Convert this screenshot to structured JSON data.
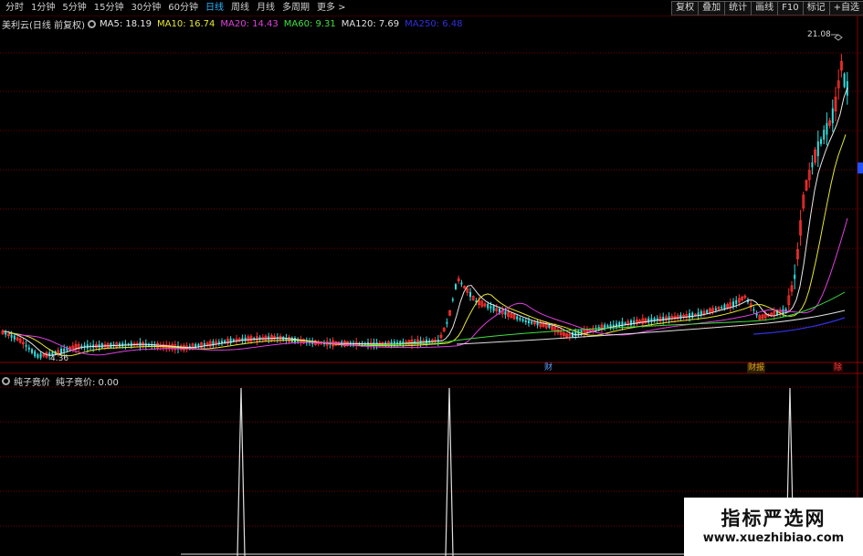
{
  "toolbar": {
    "periods": [
      {
        "label": "分时",
        "active": false
      },
      {
        "label": "1分钟",
        "active": false
      },
      {
        "label": "5分钟",
        "active": false
      },
      {
        "label": "15分钟",
        "active": false
      },
      {
        "label": "30分钟",
        "active": false
      },
      {
        "label": "60分钟",
        "active": false
      },
      {
        "label": "日线",
        "active": true
      },
      {
        "label": "周线",
        "active": false
      },
      {
        "label": "月线",
        "active": false
      },
      {
        "label": "多周期",
        "active": false
      },
      {
        "label": "更多 >",
        "active": false
      }
    ],
    "buttons": [
      "复权",
      "叠加",
      "统计",
      "画线",
      "F10",
      "标记",
      "+自选"
    ]
  },
  "legend": {
    "stock_title": "美利云(日线 前复权)",
    "ma": [
      {
        "label": "MA5: 18.19",
        "color": "#e8e8e8"
      },
      {
        "label": "MA10: 16.74",
        "color": "#e8e830"
      },
      {
        "label": "MA20: 14.43",
        "color": "#e040e0"
      },
      {
        "label": "MA60: 9.31",
        "color": "#40e040"
      },
      {
        "label": "MA120: 7.69",
        "color": "#e0e0e0"
      },
      {
        "label": "MA250: 6.48",
        "color": "#3030e0"
      }
    ]
  },
  "main_chart": {
    "high_label": "21.08",
    "low_label": "4.36",
    "event_tags": [
      {
        "text": "财",
        "color": "#5aa0ff"
      },
      {
        "text": "财报",
        "color": "#e0a020"
      },
      {
        "text": "除",
        "color": "#ff4040"
      }
    ]
  },
  "indicator": {
    "name": "纯子竟价",
    "value_label": "纯子竟价: 0.00"
  },
  "watermark": {
    "title": "指标严选网",
    "url": "www.xuezhibiao.com"
  },
  "colors": {
    "up": "#ff3030",
    "down": "#30e0e0",
    "grid": "#7a0000",
    "active_tab": "#2fb6ff"
  }
}
